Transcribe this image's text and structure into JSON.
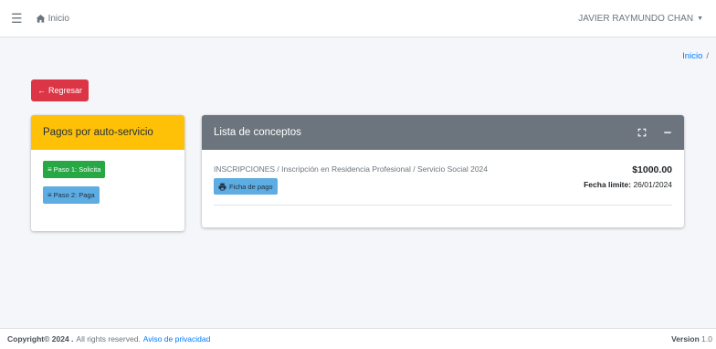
{
  "navbar": {
    "menu_icon": "hamburger-icon",
    "home_icon": "home-icon",
    "home_label": "Inicio",
    "user_name": "JAVIER RAYMUNDO CHAN",
    "caret_icon": "caret-down-icon"
  },
  "breadcrumb": {
    "home": "Inicio",
    "separator": "/"
  },
  "back_button": {
    "icon": "arrow-left-icon",
    "label": "Regresar"
  },
  "self_service": {
    "title": "Pagos por auto-servicio",
    "step1_label": "Paso 1: Solicita",
    "step2_label": "Paso 2: Paga",
    "list_icon": "list-icon"
  },
  "concepts": {
    "title": "Lista de conceptos",
    "expand_icon": "expand-icon",
    "collapse_icon": "minus-icon",
    "items": [
      {
        "description": "INSCRIPCIONES / Inscripción en Residencia Profesional / Servicio Social 2024",
        "ficha_label": "Ficha de pago",
        "ficha_icon": "print-icon",
        "amount": "$1000.00",
        "due_label": "Fecha limite:",
        "due_date": "26/01/2024"
      }
    ]
  },
  "footer": {
    "copyright": "Copyright© 2024 .",
    "rights": "All rights reserved.",
    "privacy_link": "Aviso de privacidad",
    "version_label": "Version",
    "version_number": "1.0"
  },
  "colors": {
    "warning": "#ffc107",
    "secondary": "#6c757d",
    "danger": "#dc3545",
    "success": "#28a745",
    "info": "#5dade2",
    "link": "#007bff"
  }
}
